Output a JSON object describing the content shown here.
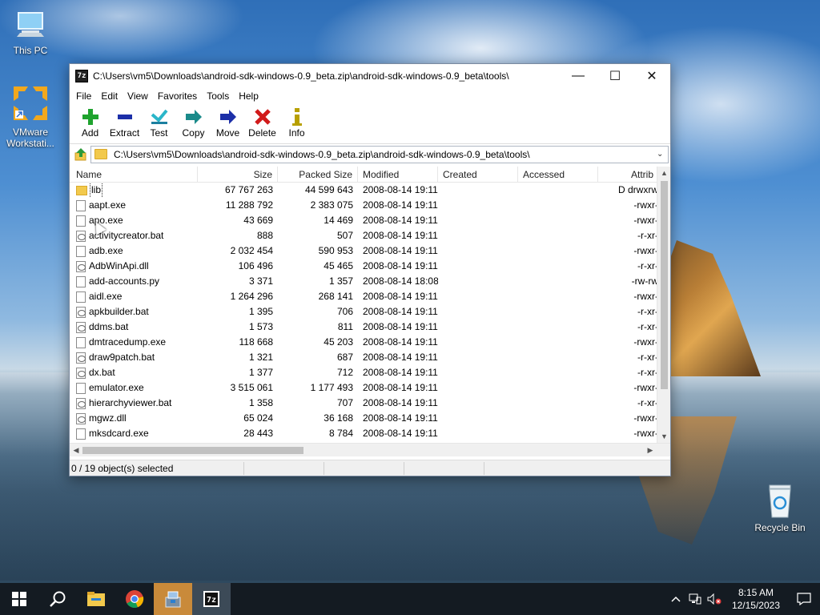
{
  "desktop": {
    "icons": [
      {
        "label": "This PC",
        "icon": "computer-icon"
      },
      {
        "label": "VMware Workstati...",
        "icon": "vmware-icon"
      },
      {
        "label": "Recycle Bin",
        "icon": "recycle-bin-icon"
      }
    ]
  },
  "window": {
    "app_icon_text": "7z",
    "title": "C:\\Users\\vm5\\Downloads\\android-sdk-windows-0.9_beta.zip\\android-sdk-windows-0.9_beta\\tools\\",
    "controls": {
      "minimize": "—",
      "maximize": "☐",
      "close": "✕"
    },
    "menu": [
      "File",
      "Edit",
      "View",
      "Favorites",
      "Tools",
      "Help"
    ],
    "toolbar": [
      {
        "label": "Add",
        "icon": "add-icon",
        "color": "#1fa32e"
      },
      {
        "label": "Extract",
        "icon": "extract-icon",
        "color": "#1c2fa8"
      },
      {
        "label": "Test",
        "icon": "test-icon",
        "color": "#2bb6c9"
      },
      {
        "label": "Copy",
        "icon": "copy-icon",
        "color": "#1a8a8a"
      },
      {
        "label": "Move",
        "icon": "move-icon",
        "color": "#1c2fa8"
      },
      {
        "label": "Delete",
        "icon": "delete-icon",
        "color": "#d11a1a"
      },
      {
        "label": "Info",
        "icon": "info-icon",
        "color": "#b8a000"
      }
    ],
    "address": "C:\\Users\\vm5\\Downloads\\android-sdk-windows-0.9_beta.zip\\android-sdk-windows-0.9_beta\\tools\\",
    "columns": [
      "Name",
      "Size",
      "Packed Size",
      "Modified",
      "Created",
      "Accessed",
      "Attrib"
    ],
    "files": [
      {
        "name": "lib",
        "type": "folder",
        "size": "67 767 263",
        "packed": "44 599 643",
        "modified": "2008-08-14 19:11",
        "created": "",
        "accessed": "",
        "attrib": "D drwxrw"
      },
      {
        "name": "aapt.exe",
        "type": "file",
        "size": "11 288 792",
        "packed": "2 383 075",
        "modified": "2008-08-14 19:11",
        "created": "",
        "accessed": "",
        "attrib": "-rwxr-"
      },
      {
        "name": "apo.exe",
        "type": "file",
        "size": "43 669",
        "packed": "14 469",
        "modified": "2008-08-14 19:11",
        "created": "",
        "accessed": "",
        "attrib": "-rwxr-"
      },
      {
        "name": "activitycreator.bat",
        "type": "bat",
        "size": "888",
        "packed": "507",
        "modified": "2008-08-14 19:11",
        "created": "",
        "accessed": "",
        "attrib": "-r-xr-"
      },
      {
        "name": "adb.exe",
        "type": "file",
        "size": "2 032 454",
        "packed": "590 953",
        "modified": "2008-08-14 19:11",
        "created": "",
        "accessed": "",
        "attrib": "-rwxr-"
      },
      {
        "name": "AdbWinApi.dll",
        "type": "bat",
        "size": "106 496",
        "packed": "45 465",
        "modified": "2008-08-14 19:11",
        "created": "",
        "accessed": "",
        "attrib": "-r-xr-"
      },
      {
        "name": "add-accounts.py",
        "type": "file",
        "size": "3 371",
        "packed": "1 357",
        "modified": "2008-08-14 18:08",
        "created": "",
        "accessed": "",
        "attrib": "-rw-rw"
      },
      {
        "name": "aidl.exe",
        "type": "file",
        "size": "1 264 296",
        "packed": "268 141",
        "modified": "2008-08-14 19:11",
        "created": "",
        "accessed": "",
        "attrib": "-rwxr-"
      },
      {
        "name": "apkbuilder.bat",
        "type": "bat",
        "size": "1 395",
        "packed": "706",
        "modified": "2008-08-14 19:11",
        "created": "",
        "accessed": "",
        "attrib": "-r-xr-"
      },
      {
        "name": "ddms.bat",
        "type": "bat",
        "size": "1 573",
        "packed": "811",
        "modified": "2008-08-14 19:11",
        "created": "",
        "accessed": "",
        "attrib": "-r-xr-"
      },
      {
        "name": "dmtracedump.exe",
        "type": "file",
        "size": "118 668",
        "packed": "45 203",
        "modified": "2008-08-14 19:11",
        "created": "",
        "accessed": "",
        "attrib": "-rwxr-"
      },
      {
        "name": "draw9patch.bat",
        "type": "bat",
        "size": "1 321",
        "packed": "687",
        "modified": "2008-08-14 19:11",
        "created": "",
        "accessed": "",
        "attrib": "-r-xr-"
      },
      {
        "name": "dx.bat",
        "type": "bat",
        "size": "1 377",
        "packed": "712",
        "modified": "2008-08-14 19:11",
        "created": "",
        "accessed": "",
        "attrib": "-r-xr-"
      },
      {
        "name": "emulator.exe",
        "type": "file",
        "size": "3 515 061",
        "packed": "1 177 493",
        "modified": "2008-08-14 19:11",
        "created": "",
        "accessed": "",
        "attrib": "-rwxr-"
      },
      {
        "name": "hierarchyviewer.bat",
        "type": "bat",
        "size": "1 358",
        "packed": "707",
        "modified": "2008-08-14 19:11",
        "created": "",
        "accessed": "",
        "attrib": "-r-xr-"
      },
      {
        "name": "mgwz.dll",
        "type": "bat",
        "size": "65 024",
        "packed": "36 168",
        "modified": "2008-08-14 19:11",
        "created": "",
        "accessed": "",
        "attrib": "-rwxr-"
      },
      {
        "name": "mksdcard.exe",
        "type": "file",
        "size": "28 443",
        "packed": "8 784",
        "modified": "2008-08-14 19:11",
        "created": "",
        "accessed": "",
        "attrib": "-rwxr-"
      }
    ],
    "status": "0 / 19 object(s) selected"
  },
  "taskbar": {
    "clock_time": "8:15 AM",
    "clock_date": "12/15/2023"
  },
  "colors": {
    "taskbar": "#141b22",
    "folder": "#f2c94c"
  }
}
